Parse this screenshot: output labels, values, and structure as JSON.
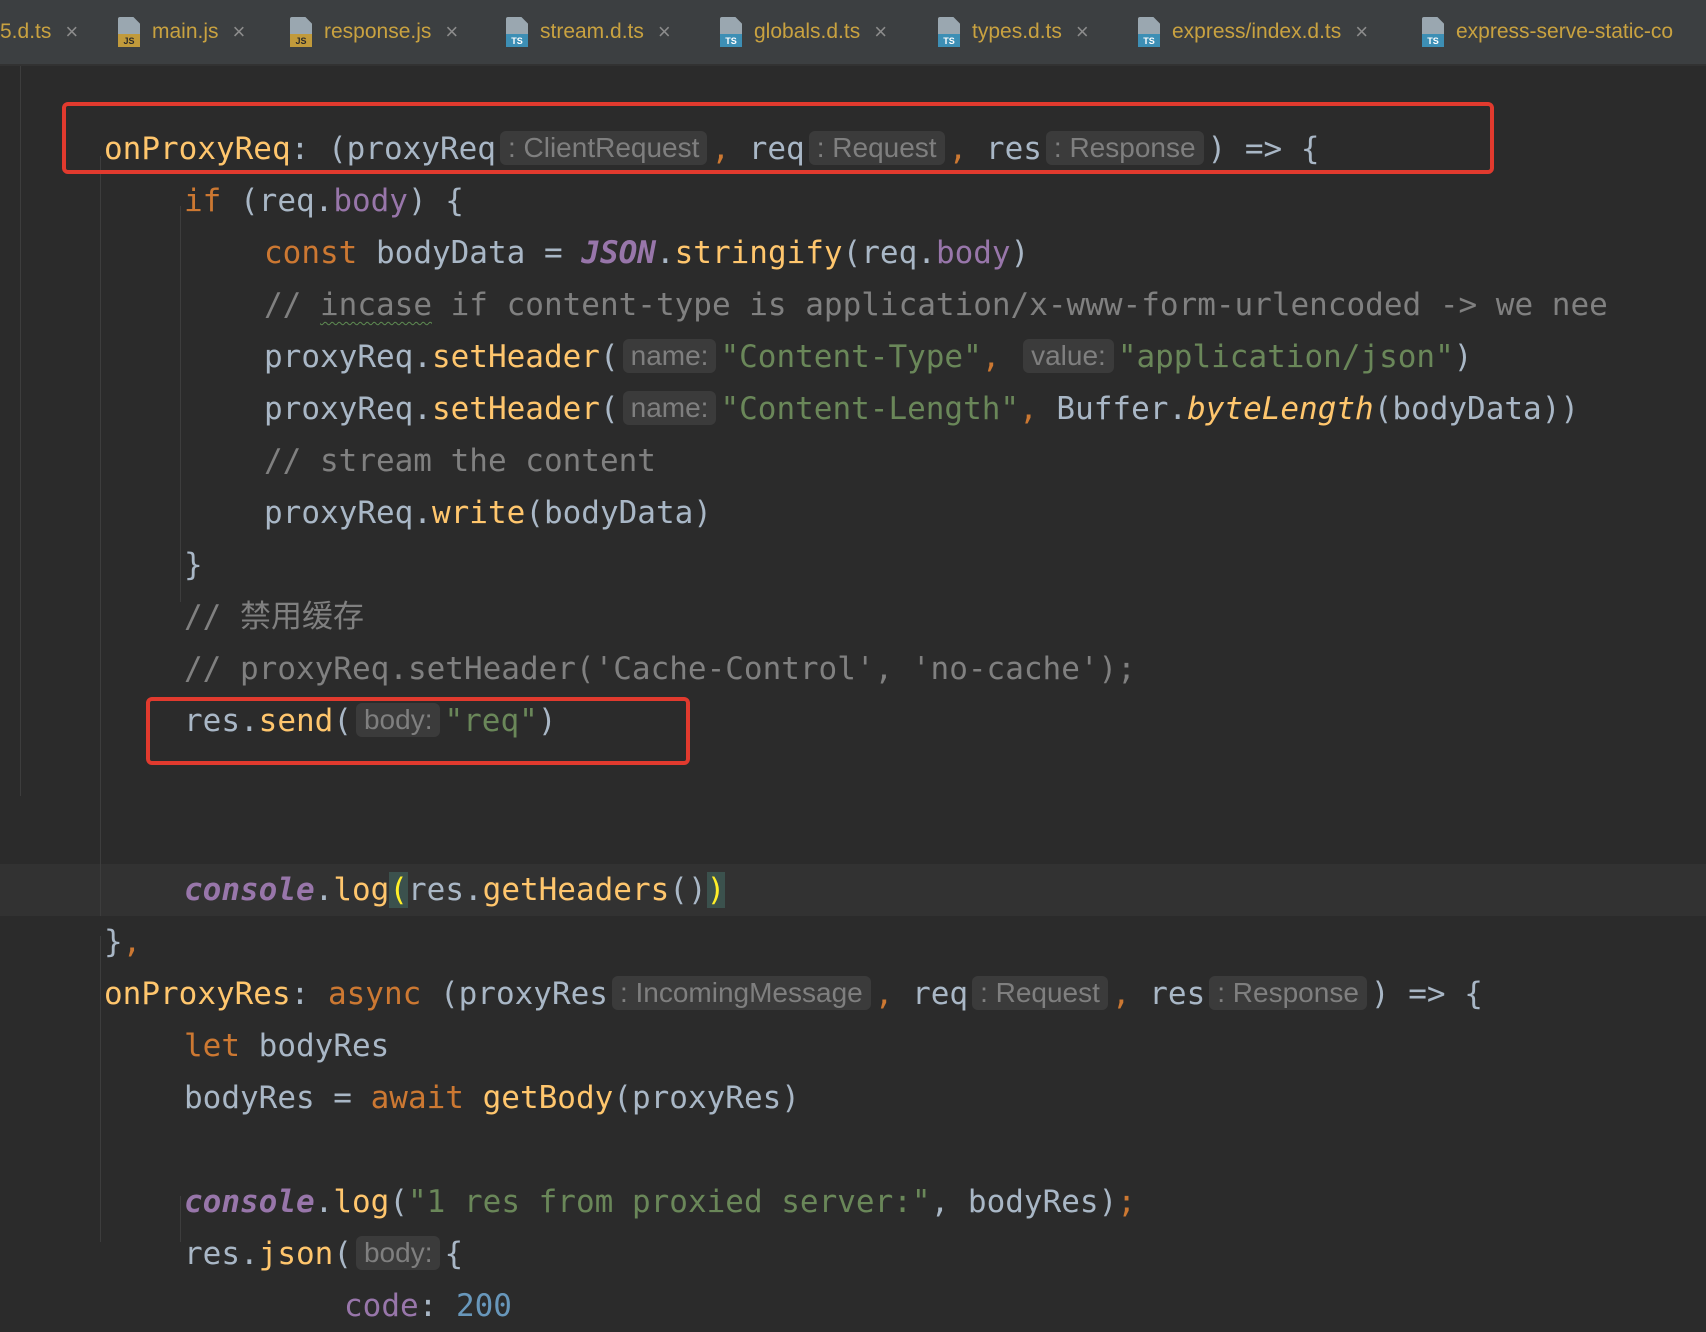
{
  "tabs": [
    {
      "name": "5.d.ts",
      "type": "ts"
    },
    {
      "name": "main.js",
      "type": "js"
    },
    {
      "name": "response.js",
      "type": "js"
    },
    {
      "name": "stream.d.ts",
      "type": "ts"
    },
    {
      "name": "globals.d.ts",
      "type": "ts"
    },
    {
      "name": "types.d.ts",
      "type": "ts"
    },
    {
      "name": "express/index.d.ts",
      "type": "ts"
    },
    {
      "name": "express-serve-static-co",
      "type": "ts"
    }
  ],
  "icons": {
    "close": "close-icon",
    "file_js": "js-file-icon",
    "file_ts": "ts-file-icon"
  },
  "colors": {
    "highlight_box": "#e13a2e",
    "tab_text": "#c9a240",
    "editor_bg": "#2b2b2b"
  },
  "code": {
    "l1": {
      "a": "onProxyReq",
      "b": ": (proxyReq",
      "hint1": ": ClientRequest",
      "c": ", ",
      "d": "req",
      "hint2": ": Request",
      "e": ", ",
      "f": "res",
      "hint3": ": Response",
      "g": ") => {"
    },
    "l2": {
      "a": "if",
      "b": " (req.",
      "c": "body",
      "d": ") {"
    },
    "l3": {
      "a": "const",
      "b": " bodyData = ",
      "c": "JSON",
      "d": ".",
      "e": "stringify",
      "f": "(req.",
      "g": "body",
      "h": ")"
    },
    "l4": {
      "a": "// ",
      "b": "incase",
      "c": " if content-type is application/x-www-form-urlencoded -> we nee"
    },
    "l5": {
      "a": "proxyReq.",
      "b": "setHeader",
      "c": "(",
      "hint1": "name:",
      "d": "\"Content-Type\"",
      "e": ", ",
      "hint2": "value:",
      "f": "\"application/json\"",
      "g": ")"
    },
    "l6": {
      "a": "proxyReq.",
      "b": "setHeader",
      "c": "(",
      "hint1": "name:",
      "d": "\"Content-Length\"",
      "e": ", ",
      "f": "Buffer.",
      "g": "byteLength",
      "h": "(bodyData))"
    },
    "l7": {
      "a": "// stream the content"
    },
    "l8": {
      "a": "proxyReq.",
      "b": "write",
      "c": "(bodyData)"
    },
    "l9": {
      "a": "}"
    },
    "l10": {
      "a": "// 禁用缓存"
    },
    "l11": {
      "a": "// proxyReq.setHeader('Cache-Control', 'no-cache');"
    },
    "l12": {
      "a": "res.",
      "b": "send",
      "c": "(",
      "hint1": "body:",
      "d": "\"req\"",
      "e": ")"
    },
    "l14": {
      "a": "console",
      "b": ".",
      "c": "log",
      "d": "(",
      "e": "res.",
      "f": "getHeaders",
      "g": "()",
      "h": ")"
    },
    "l15": {
      "a": "}",
      "b": ","
    },
    "l16": {
      "a": "onProxyRes",
      "b": ": ",
      "c": "async",
      "d": " (proxyRes",
      "hint1": ": IncomingMessage",
      "e": ", ",
      "f": "req",
      "hint2": ": Request",
      "g": ", ",
      "h": "res",
      "hint3": ": Response",
      "i": ") => {"
    },
    "l17": {
      "a": "let",
      "b": " bodyRes"
    },
    "l18": {
      "a": "bodyRes = ",
      "b": "await",
      "c": " ",
      "d": "getBody",
      "e": "(proxyRes)"
    },
    "l20": {
      "a": "console",
      "b": ".",
      "c": "log",
      "d": "(",
      "e": "\"1 res from proxied server:\"",
      "f": ", bodyRes)",
      "g": ";"
    },
    "l21": {
      "a": "res.",
      "b": "json",
      "c": "(",
      "hint1": "body:",
      "d": "{"
    },
    "l22": {
      "a": "code",
      "b": ": ",
      "c": "200"
    }
  }
}
